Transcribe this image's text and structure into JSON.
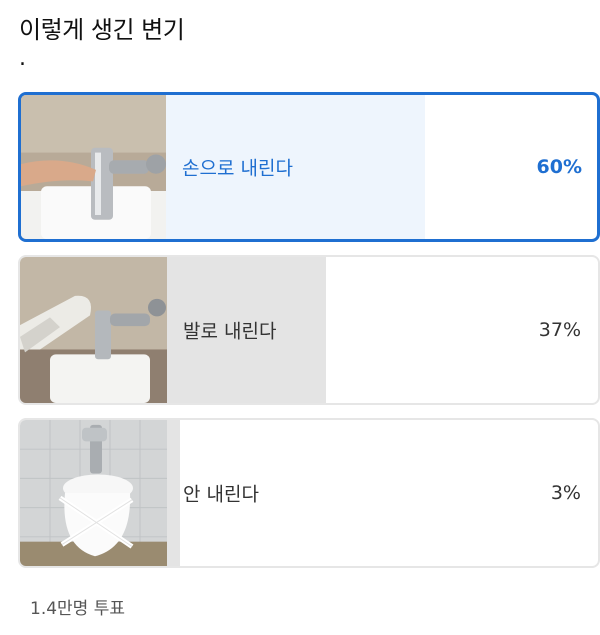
{
  "poll": {
    "title": "이렇게 생긴 변기",
    "subtitle": ".",
    "options": [
      {
        "label": "손으로 내린다",
        "percent_text": "60%",
        "percent": 60,
        "selected": true
      },
      {
        "label": "발로 내린다",
        "percent_text": "37%",
        "percent": 37,
        "selected": false
      },
      {
        "label": "안 내린다",
        "percent_text": "3%",
        "percent": 3,
        "selected": false
      }
    ],
    "vote_count": "1.4만명 투표"
  },
  "colors": {
    "accent": "#1f6fd1",
    "selected_bar": "#eef5fd",
    "bar": "#e4e4e4",
    "border": "#e6e6e6"
  },
  "images": [
    "hand-flushing-photo",
    "foot-flushing-photo",
    "toilet-taped-shut-photo"
  ]
}
